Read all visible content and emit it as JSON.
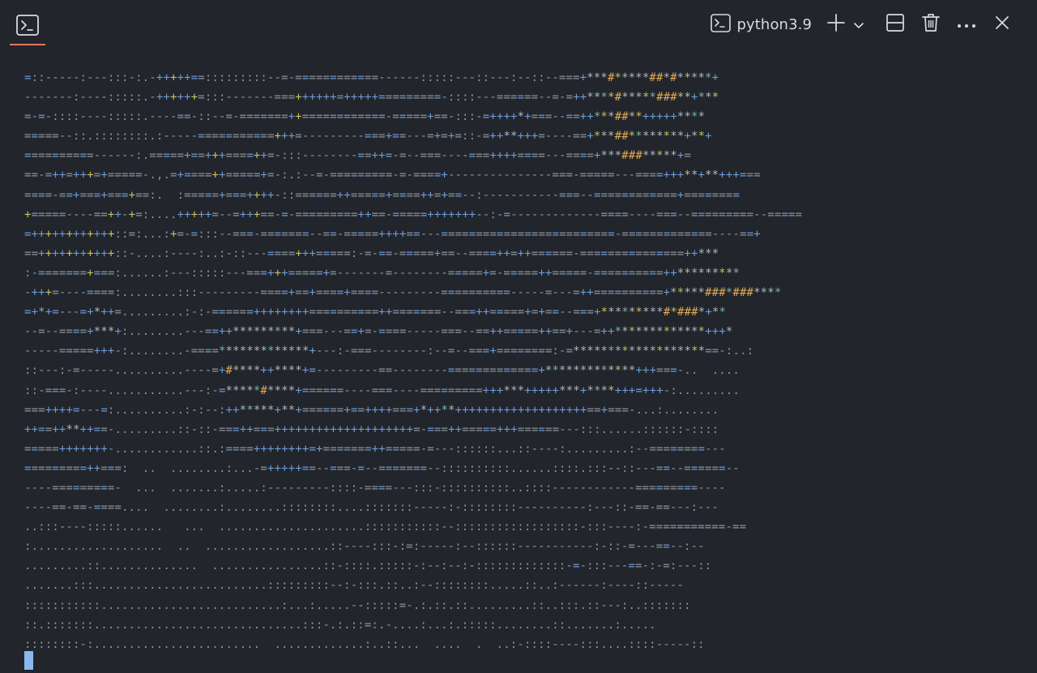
{
  "header": {
    "left_icon": "terminal-icon",
    "profile": {
      "icon": "terminal-icon",
      "label": "python3.9"
    },
    "actions": [
      "plus-icon",
      "chevron-down-icon",
      "split-icon",
      "trash-icon",
      "ellipsis-icon",
      "close-icon"
    ]
  },
  "colors": {
    "background": "#22252b",
    "accent_underline": "#e2775b",
    "cursor": "#8ab7f0",
    "blue": "#6c9bd8",
    "teal": "#79b6ae",
    "yellow": "#c9c15c",
    "gold": "#e0a956"
  },
  "terminal": {
    "lines": [
      "=::-----:---:::-:.-+++++==:::::::::--=-============------:::::---::---:--::--===+***#*****##*#*****+",
      "-------:----:::::.-++++++=:::-------===++++++=+++++=========-::::---======--=-=++****#*****###**+***",
      "=-=-::::----:::::.----==-::--=-=======++============-=====+==-:::-=++++*+===--==++***##**+++++****",
      "=====--::.::::::::.:-----===========+++=---------===+==---=+=+=::-=++**+++=----==+***##********+**+",
      "==========------:.=====+==+++====++=-:::--------==++=-=--===----===++++====---====+***###*****+=",
      "==-=++=+++=+=====-.,.=+====++=====+=-:.:--=-=========-=-====+---------------===-=====---====+++**+**+++===",
      "====-==+===+===+==:.  :=====+===++++-::======++=====+====++=+==--:-----------===--============+========",
      "+=====----==++-+=:....+++++=--=+++==-=-=========++==-=====+++++++--:-=-------------====----===--=========--=====",
      "=++++++++++++::=:...:+=-=:::--===-=======--==-=====++++==---=========================-=============----==+",
      "==+++++++++++::-....:----:..:-::---====+++=====:-=-==-=====+==--====++=++======-===============++***",
      ":-=======+===:......:---:::::---===+++=====+=-------=--------=====+=-=====++=====-==========++*********",
      "-+++=----====:........:::---------====+==+====+====---------==========-----=---=++==========+*****###*###****",
      "=+*+=---=+*++=.........:-:-======++++++++==========++=======--===++=====+=+==--===+*********#*###*+**",
      "--=--====+***+:........---==++*********+===---==+=-====-----===--==++=====++==+---=++*************+++*",
      "-----=====+++-:........-====*************+---:-===--------:--=--===+========:-=*******************==-:..:",
      "::---:-=-----..........----=+#****++****+=---------==--------=============+*************+++===-..  ....",
      "::-===-:----...........---:-=*****#****+======----===----=========+++***+++++***+****+++=+++-:.........",
      "===++++=---=:..........:-:--:++*****+**+======+==++++===+*++**+++++++++++++++++++==+===-...:........",
      "++==++**++==-.........::-::-===++===++++++++++++++++++++=-===++=====+++======---:::......::::::-::::",
      "=====+++++++-............::.:====++++++++=+=======++=====-=---::::::...::----:.........:--========---",
      "=========++===:  ..  ........:...-=+++++==--===-=--=======--::::::::::......::::.:::--::---==--======--",
      "----=========-  ...  .......:.....:---------::::-====---:::-::::::::::..::::------------=========----",
      "----==-==-====....  ........:........::::::::....:::::::-----:-::::::::----------:---::-==-==---:---",
      "..:::----:::::......   ...  .....................:::::::::::--::::::::::::::::::-:::----:-===========-==",
      ":...................  ..  ..................::----:::-:=:-----:--::::::-----------:-::-=---==--:--",
      ".........::..............  ................::-::::.:::::-:--:--:-:::::::::::::-=-:::---==-:-=:---::",
      ".......:::.........................:::::::::--:-:::.::..:--::::::::.....::..:------:----::-----",
      ":::::::::::..........................:...:.....--:::::=-.:.::.::.........::..:::.::---:..:::::::",
      "::.:::::::..............................:::-.:.::=:.-....:...:.:::::........::.......:.....",
      "::::::::-:........................  .............:..::...  ....  .  ..:-::::----:::....::::-----::"
    ]
  }
}
